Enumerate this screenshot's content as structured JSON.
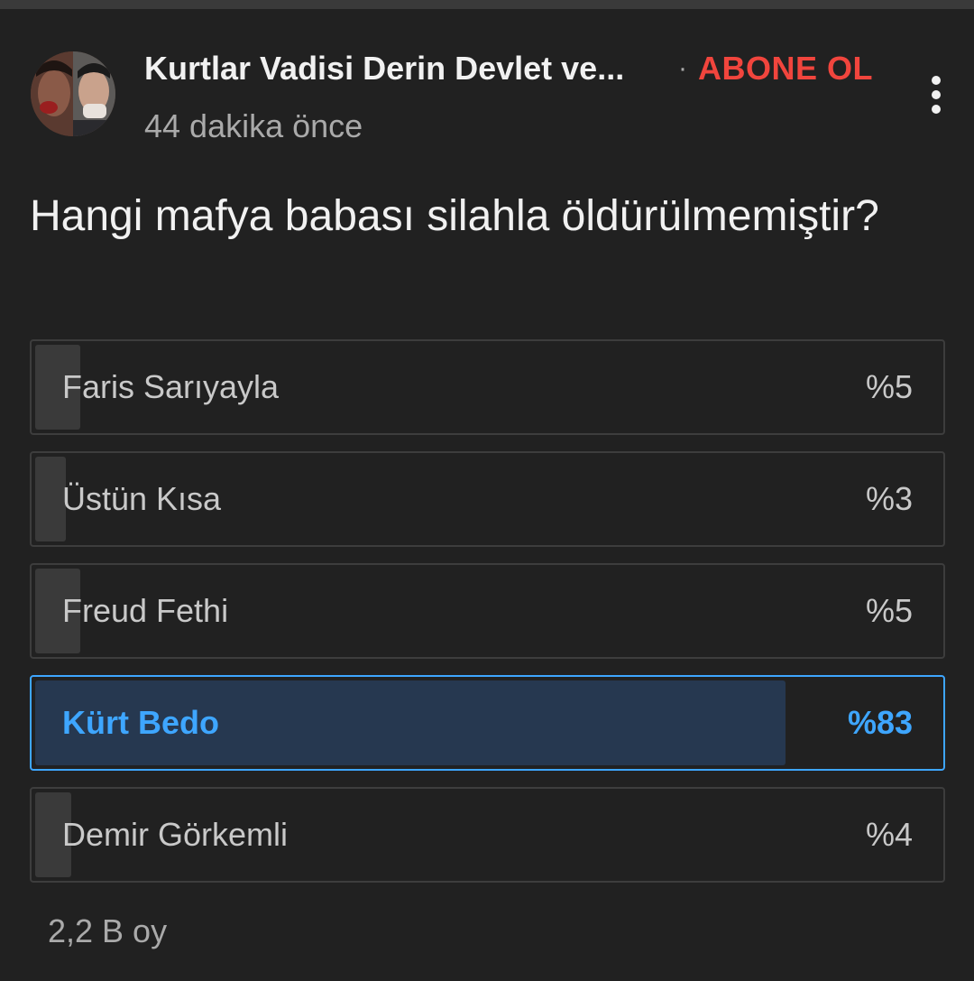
{
  "post": {
    "channel_name": "Kurtlar Vadisi Derin Devlet ve...",
    "separator": "·",
    "subscribe_label": "ABONE OL",
    "timestamp": "44 dakika önce",
    "avatar_icon": "channel-avatar-photo",
    "more_icon": "vertical-dots-icon"
  },
  "poll": {
    "question": "Hangi mafya babası silahla öldürülmemiştir?",
    "options": [
      {
        "label": "Faris Sarıyayla",
        "percent_text": "%5",
        "percent": 5,
        "selected": false
      },
      {
        "label": "Üstün Kısa",
        "percent_text": "%3",
        "percent": 3,
        "selected": false
      },
      {
        "label": "Freud Fethi",
        "percent_text": "%5",
        "percent": 5,
        "selected": false
      },
      {
        "label": "Kürt Bedo",
        "percent_text": "%83",
        "percent": 83,
        "selected": true
      },
      {
        "label": "Demir Görkemli",
        "percent_text": "%4",
        "percent": 4,
        "selected": false
      }
    ],
    "vote_count": "2,2 B oy"
  },
  "colors": {
    "background": "#212121",
    "accent_blue": "#3ea6ff",
    "subscribe_red": "#f1453d",
    "bar_fill": "#3a3a3a",
    "selected_fill": "#263850"
  }
}
